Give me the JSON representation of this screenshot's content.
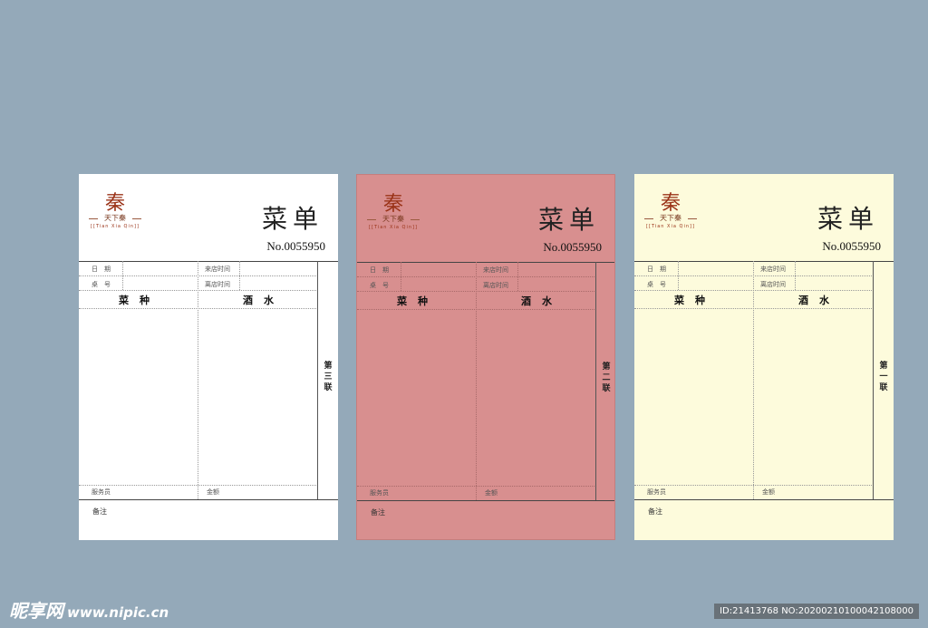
{
  "form": {
    "logo_char": "秦",
    "logo_sub": "天下秦",
    "logo_pinyin": "[[Tian Xia Qin]]",
    "title": "菜单",
    "number": "No.0055950",
    "date_label": "日　期",
    "arrival_label": "来店时间",
    "table_label": "桌　号",
    "leave_label": "离店时间",
    "dishes_header": "菜种",
    "drinks_header": "酒水",
    "waiter_label": "服务员",
    "amount_label": "金额",
    "remark_label": "备注"
  },
  "sheets": [
    {
      "copy_label": "第三联",
      "color": "#ffffff"
    },
    {
      "copy_label": "第二联",
      "color": "#d88f8f"
    },
    {
      "copy_label": "第一联",
      "color": "#fdfbdc"
    }
  ],
  "background_color": "#94a9b9",
  "watermark": {
    "brand": "昵享网",
    "url": "www.nipic.cn",
    "id_text": "ID:21413768 NO:20200210100042108000"
  }
}
